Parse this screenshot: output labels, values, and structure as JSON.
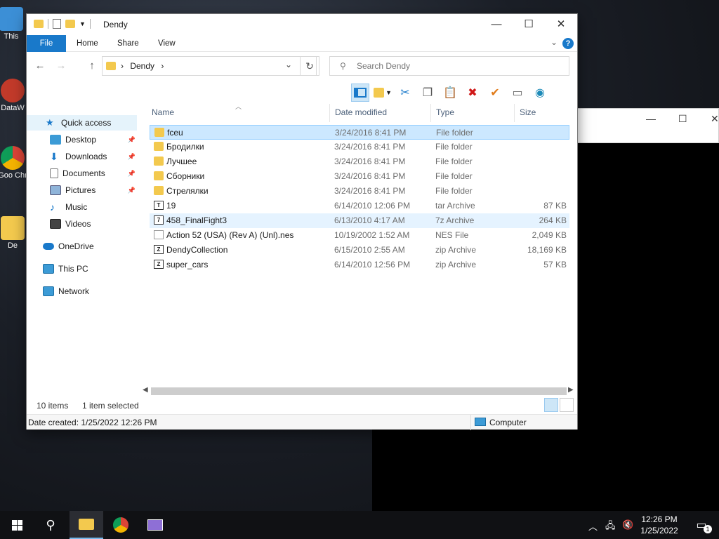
{
  "desktop": {
    "icons": [
      {
        "label": "This"
      },
      {
        "label": "DataW"
      },
      {
        "label": "Goo Chr"
      },
      {
        "label": "De"
      }
    ]
  },
  "window": {
    "title": "Dendy",
    "controls": {
      "minimize": "—",
      "maximize": "☐",
      "close": "✕"
    }
  },
  "ribbon": {
    "tabs": [
      {
        "label": "File"
      },
      {
        "label": "Home"
      },
      {
        "label": "Share"
      },
      {
        "label": "View"
      }
    ],
    "help": "?"
  },
  "address": {
    "crumb": "Dendy",
    "separator": "›",
    "back": "←",
    "forward": "→",
    "up": "↑",
    "refresh": "↻"
  },
  "search": {
    "placeholder": "Search Dendy"
  },
  "toolbar": {
    "icons": [
      "preview-pane-icon",
      "new-folder-icon",
      "cut-icon",
      "copy-icon",
      "paste-icon",
      "delete-icon",
      "check-icon",
      "rename-icon",
      "globe-icon"
    ]
  },
  "navpane": {
    "items": [
      {
        "label": "Quick access",
        "icon": "star-icon",
        "pinned": false
      },
      {
        "label": "Desktop",
        "icon": "desktop-icon",
        "pinned": true
      },
      {
        "label": "Downloads",
        "icon": "download-icon",
        "pinned": true
      },
      {
        "label": "Documents",
        "icon": "documents-icon",
        "pinned": true
      },
      {
        "label": "Pictures",
        "icon": "pictures-icon",
        "pinned": true
      },
      {
        "label": "Music",
        "icon": "music-icon",
        "pinned": false
      },
      {
        "label": "Videos",
        "icon": "videos-icon",
        "pinned": false
      },
      {
        "label": "OneDrive",
        "icon": "cloud-icon",
        "pinned": false
      },
      {
        "label": "This PC",
        "icon": "computer-icon",
        "pinned": false
      },
      {
        "label": "Network",
        "icon": "network-icon",
        "pinned": false
      }
    ]
  },
  "columns": {
    "name": "Name",
    "date": "Date modified",
    "type": "Type",
    "size": "Size"
  },
  "files": [
    {
      "name": "fceu",
      "date": "3/24/2016 8:41 PM",
      "type": "File folder",
      "size": "",
      "kind": "folder",
      "selected": true
    },
    {
      "name": "Бродилки",
      "date": "3/24/2016 8:41 PM",
      "type": "File folder",
      "size": "",
      "kind": "folder"
    },
    {
      "name": "Лучшее",
      "date": "3/24/2016 8:41 PM",
      "type": "File folder",
      "size": "",
      "kind": "folder"
    },
    {
      "name": "Сборники",
      "date": "3/24/2016 8:41 PM",
      "type": "File folder",
      "size": "",
      "kind": "folder"
    },
    {
      "name": "Стрелялки",
      "date": "3/24/2016 8:41 PM",
      "type": "File folder",
      "size": "",
      "kind": "folder"
    },
    {
      "name": "19",
      "date": "6/14/2010 12:06 PM",
      "type": "tar Archive",
      "size": "87 KB",
      "kind": "archive",
      "badge": "T"
    },
    {
      "name": "458_FinalFight3",
      "date": "6/13/2010 4:17 AM",
      "type": "7z Archive",
      "size": "264 KB",
      "kind": "archive",
      "badge": "7",
      "hover": true
    },
    {
      "name": "Action 52 (USA) (Rev A) (Unl).nes",
      "date": "10/19/2002 1:52 AM",
      "type": "NES File",
      "size": "2,049 KB",
      "kind": "file"
    },
    {
      "name": "DendyCollection",
      "date": "6/15/2010 2:55 AM",
      "type": "zip Archive",
      "size": "18,169 KB",
      "kind": "archive",
      "badge": "Z"
    },
    {
      "name": "super_cars",
      "date": "6/14/2010 12:56 PM",
      "type": "zip Archive",
      "size": "57 KB",
      "kind": "archive",
      "badge": "Z"
    }
  ],
  "status": {
    "count": "10 items",
    "selected": "1 item selected"
  },
  "details": {
    "created": "Date created: 1/25/2022 12:26 PM",
    "zone": "Computer"
  },
  "taskbar": {
    "time": "12:26 PM",
    "date": "1/25/2022",
    "notification_count": "1"
  }
}
